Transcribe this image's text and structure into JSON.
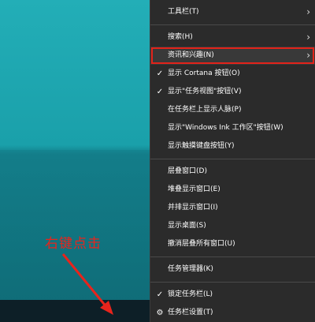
{
  "annotation": {
    "label": "右键点击",
    "color": "#e8241c"
  },
  "menu": {
    "groups": [
      [
        {
          "label": "工具栏(T)",
          "submenu": true,
          "checked": false,
          "icon": null,
          "highlight": false
        }
      ],
      [
        {
          "label": "搜索(H)",
          "submenu": true,
          "checked": false,
          "icon": null,
          "highlight": false
        },
        {
          "label": "资讯和兴趣(N)",
          "submenu": true,
          "checked": false,
          "icon": null,
          "highlight": true
        },
        {
          "label": "显示 Cortana 按钮(O)",
          "submenu": false,
          "checked": true,
          "icon": null,
          "highlight": false
        },
        {
          "label": "显示\"任务视图\"按钮(V)",
          "submenu": false,
          "checked": true,
          "icon": null,
          "highlight": false
        },
        {
          "label": "在任务栏上显示人脉(P)",
          "submenu": false,
          "checked": false,
          "icon": null,
          "highlight": false
        },
        {
          "label": "显示\"Windows Ink 工作区\"按钮(W)",
          "submenu": false,
          "checked": false,
          "icon": null,
          "highlight": false
        },
        {
          "label": "显示触摸键盘按钮(Y)",
          "submenu": false,
          "checked": false,
          "icon": null,
          "highlight": false
        }
      ],
      [
        {
          "label": "层叠窗口(D)",
          "submenu": false,
          "checked": false,
          "icon": null,
          "highlight": false
        },
        {
          "label": "堆叠显示窗口(E)",
          "submenu": false,
          "checked": false,
          "icon": null,
          "highlight": false
        },
        {
          "label": "并排显示窗口(I)",
          "submenu": false,
          "checked": false,
          "icon": null,
          "highlight": false
        },
        {
          "label": "显示桌面(S)",
          "submenu": false,
          "checked": false,
          "icon": null,
          "highlight": false
        },
        {
          "label": "撤消层叠所有窗口(U)",
          "submenu": false,
          "checked": false,
          "icon": null,
          "highlight": false
        }
      ],
      [
        {
          "label": "任务管理器(K)",
          "submenu": false,
          "checked": false,
          "icon": null,
          "highlight": false
        }
      ],
      [
        {
          "label": "锁定任务栏(L)",
          "submenu": false,
          "checked": true,
          "icon": null,
          "highlight": false
        },
        {
          "label": "任务栏设置(T)",
          "submenu": false,
          "checked": false,
          "icon": "gear-icon",
          "highlight": false
        }
      ]
    ]
  }
}
